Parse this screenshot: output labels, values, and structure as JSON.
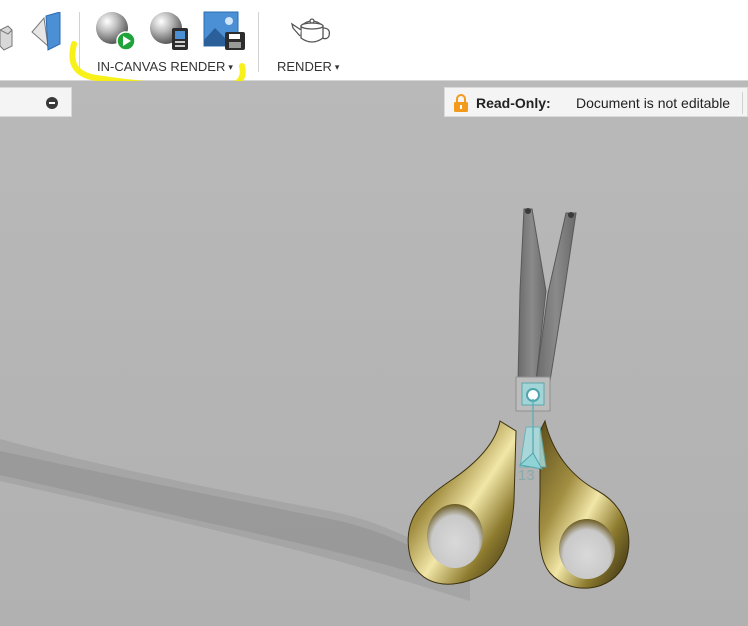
{
  "toolbar": {
    "groups": [
      {
        "label": "IN-CANVAS RENDER",
        "has_dropdown": true,
        "highlighted": true
      },
      {
        "label": "RENDER",
        "has_dropdown": true
      }
    ],
    "dropdown_glyph": "▾",
    "icons": [
      "box-view-icon",
      "appearance-icon",
      "start-in-canvas-render-icon",
      "in-canvas-render-settings-icon",
      "capture-image-icon",
      "render-teapot-icon"
    ],
    "highlight_color": "#f6f000"
  },
  "browser": {
    "collapse_icon": "minus-circle-icon"
  },
  "status": {
    "readonly_label": "Read-Only:",
    "readonly_message": "Document is not editable",
    "lock_color": "#f29a1c"
  },
  "canvas": {
    "model": "scissors",
    "dimension_label": "13",
    "handle_color": "#8c7a2e",
    "blade_color": "#7d7d7d",
    "manipulator_color": "#8fd3d6"
  }
}
